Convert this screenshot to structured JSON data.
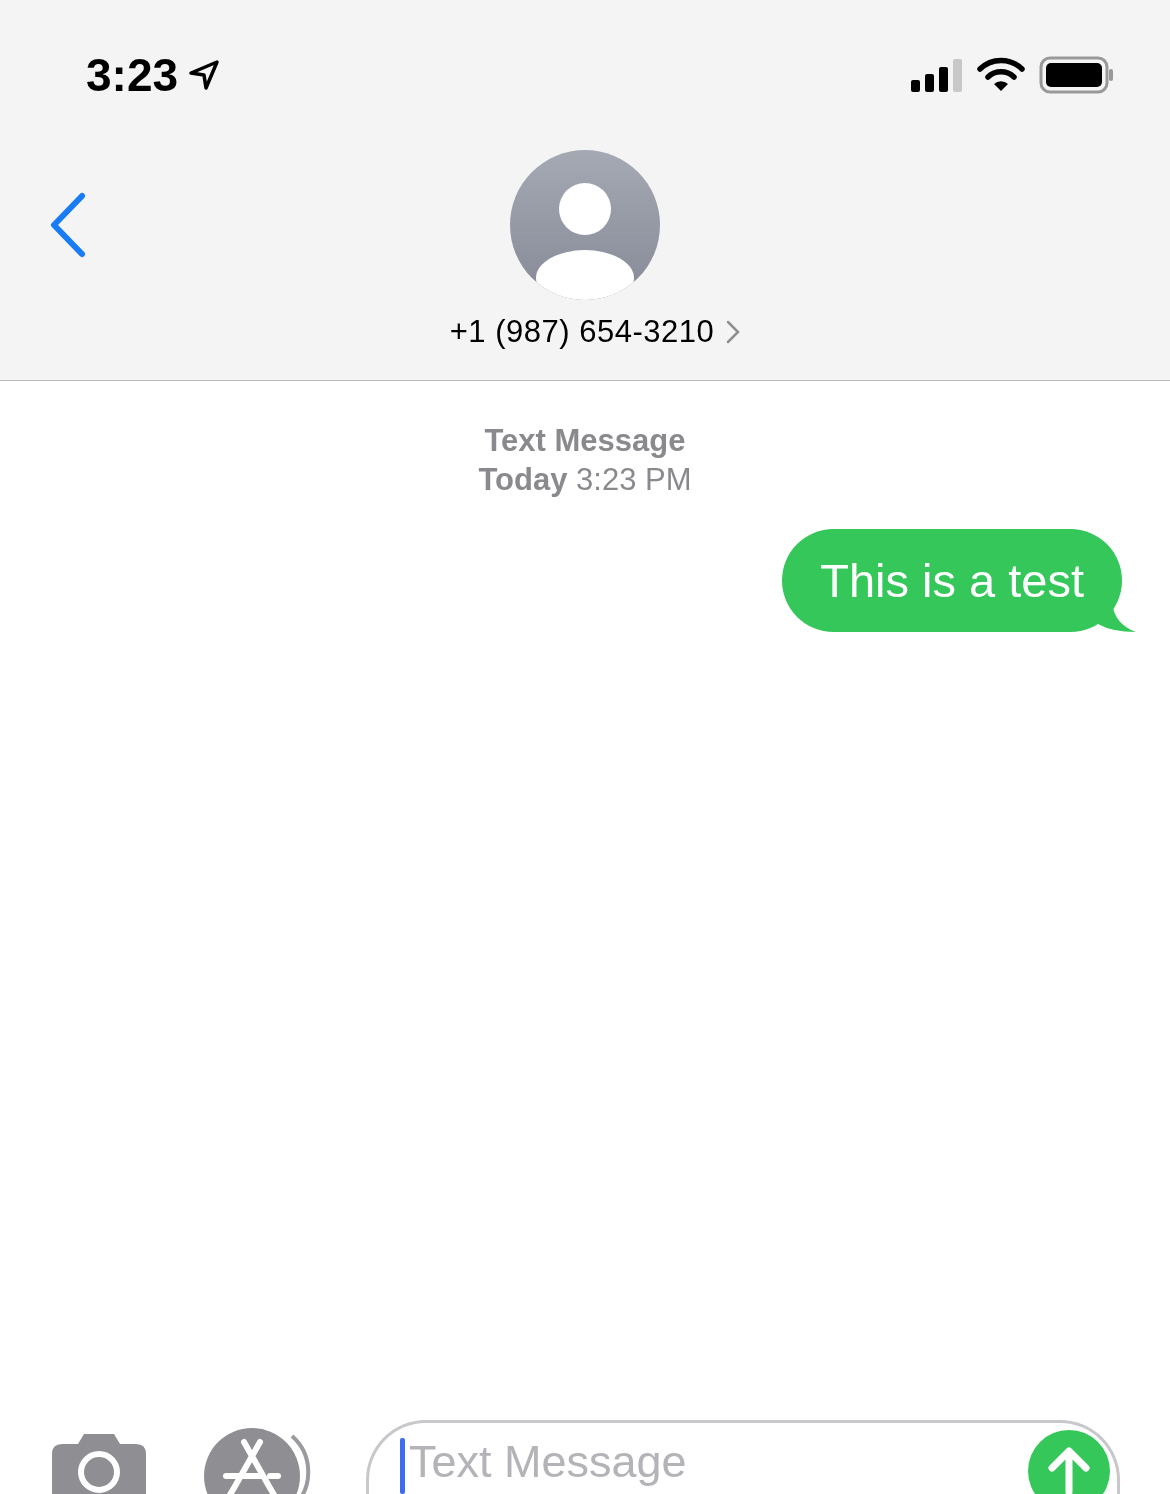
{
  "status_bar": {
    "time": "3:23"
  },
  "header": {
    "contact": "+1 (987) 654-3210"
  },
  "conversation": {
    "service": "Text Message",
    "timestamp": "**Today** 3:23 PM",
    "messages": [
      {
        "kind": "sent",
        "text": "This is a test"
      }
    ]
  },
  "composer": {
    "placeholder": "Text Message"
  }
}
